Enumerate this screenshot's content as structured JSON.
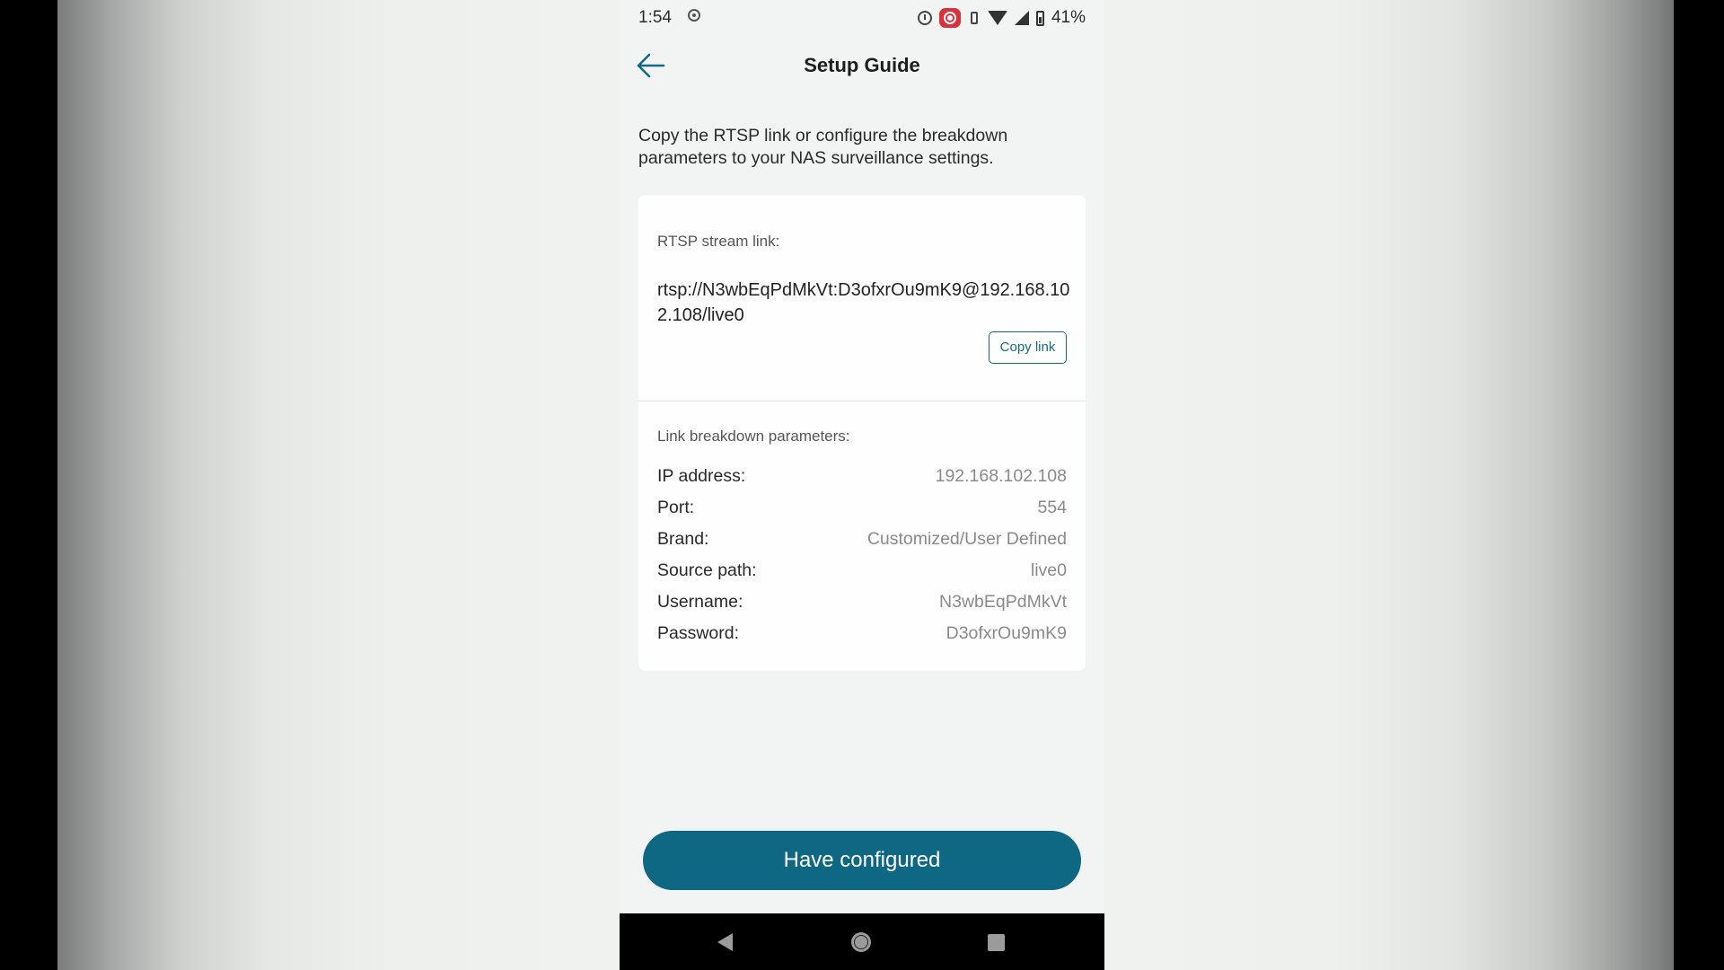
{
  "status_bar": {
    "time": "1:54",
    "battery_percent": "41%",
    "icons": [
      "screen-record-icon",
      "alarm-icon",
      "record-app-icon",
      "vibrate-icon",
      "wifi-icon",
      "signal-icon",
      "battery-icon"
    ]
  },
  "header": {
    "title": "Setup Guide",
    "back_icon": "arrow-left-icon"
  },
  "intro": "Copy the RTSP link or configure the breakdown parameters to your NAS surveillance settings.",
  "stream": {
    "label": "RTSP stream link:",
    "link": "rtsp://N3wbEqPdMkVt:D3ofxrOu9mK9@192.168.102.108/live0",
    "copy_label": "Copy link"
  },
  "breakdown": {
    "label": "Link breakdown parameters:",
    "rows": [
      {
        "label": "IP address:",
        "value": "192.168.102.108"
      },
      {
        "label": "Port:",
        "value": "554"
      },
      {
        "label": "Brand:",
        "value": "Customized/User Defined"
      },
      {
        "label": "Source path:",
        "value": "live0"
      },
      {
        "label": "Username:",
        "value": "N3wbEqPdMkVt"
      },
      {
        "label": "Password:",
        "value": "D3ofxrOu9mK9"
      }
    ]
  },
  "primary_button": "Have configured",
  "colors": {
    "accent": "#0e6783",
    "background": "#f2f4f3",
    "card": "#fdfefd"
  }
}
